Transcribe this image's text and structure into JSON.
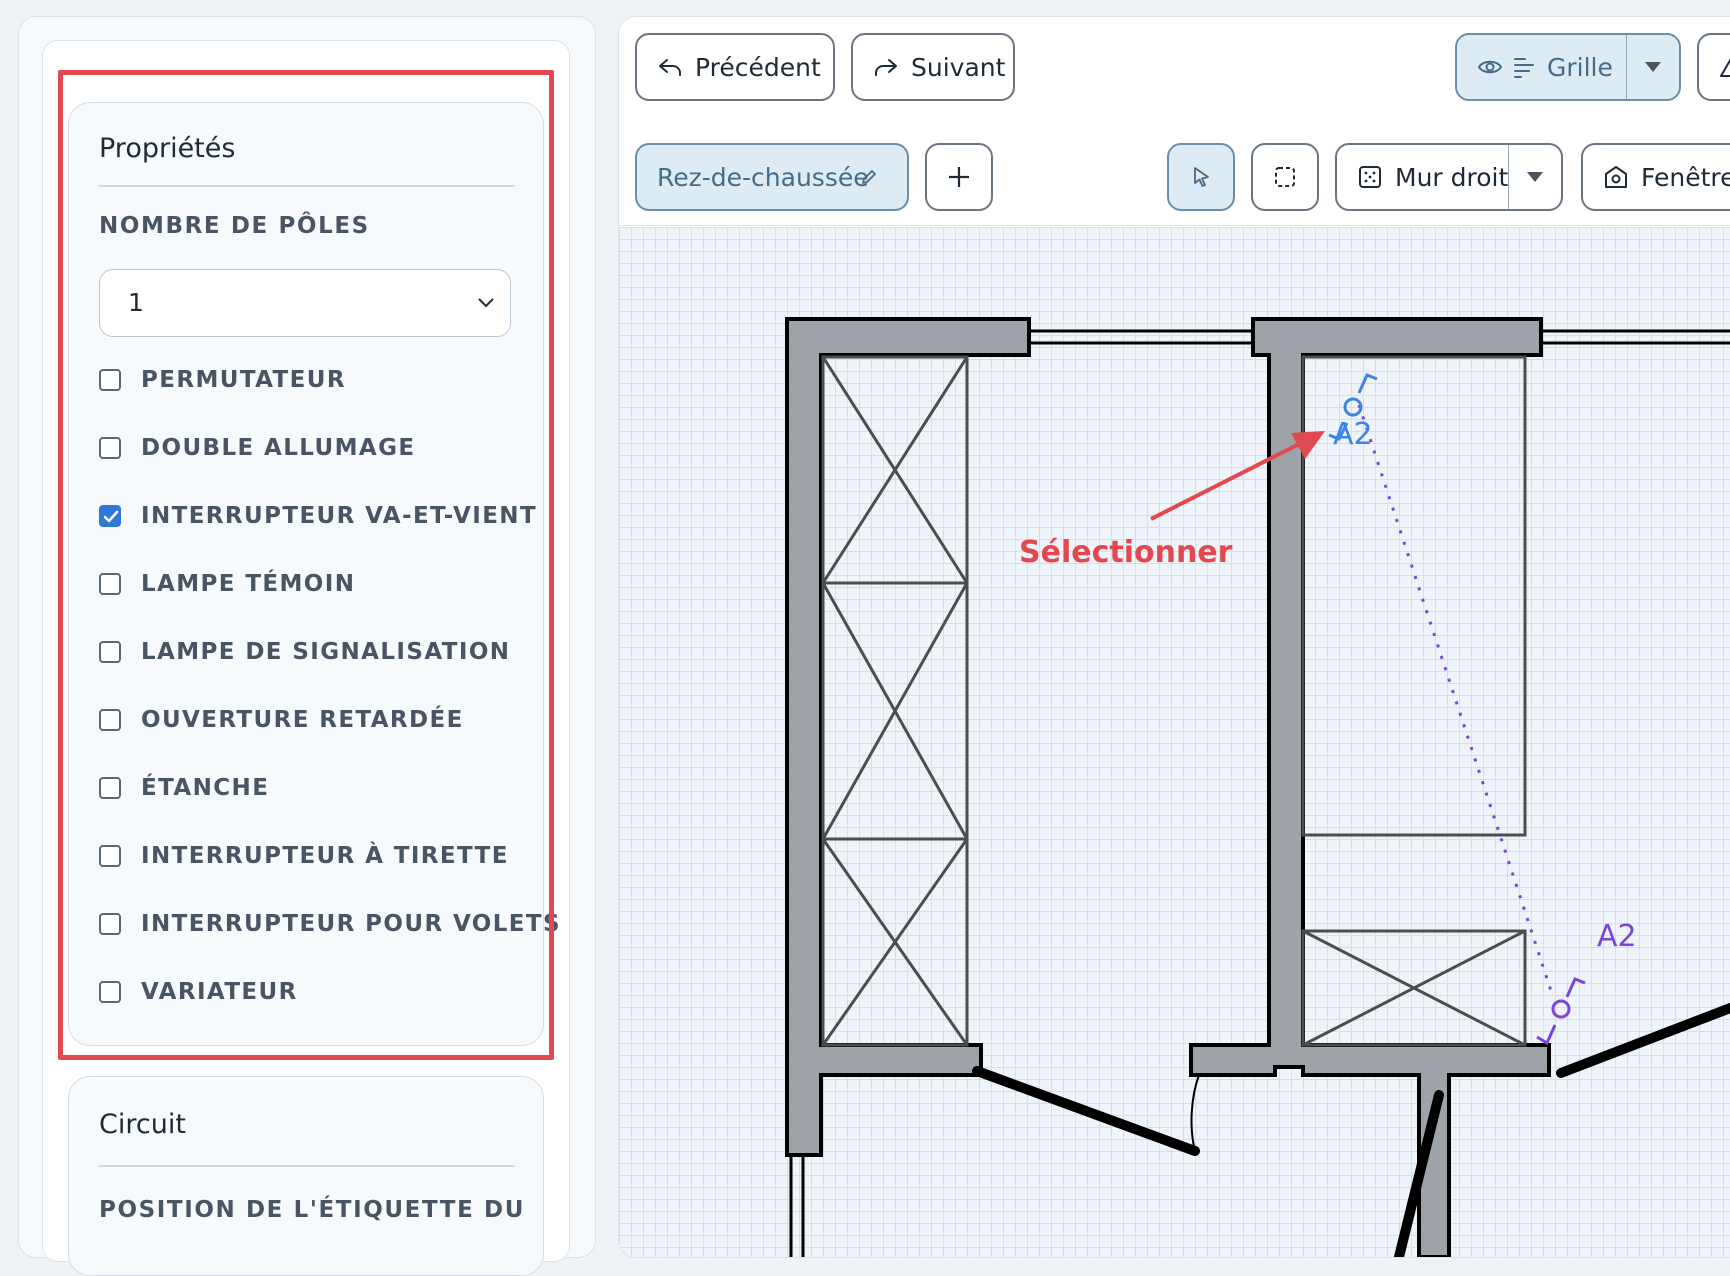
{
  "toolbar": {
    "previous_label": "Précédent",
    "next_label": "Suivant",
    "grid_label": "Grille"
  },
  "floor": {
    "level_label": "Rez-de-chaussée",
    "wall_tool_label": "Mur droit",
    "window_tool_label": "Fenêtre"
  },
  "properties": {
    "title": "Propriétés",
    "poles_label": "NOMBRE DE PÔLES",
    "poles_value": "1",
    "options": [
      {
        "label": "PERMUTATEUR",
        "checked": false
      },
      {
        "label": "DOUBLE ALLUMAGE",
        "checked": false
      },
      {
        "label": "INTERRUPTEUR VA-ET-VIENT",
        "checked": true
      },
      {
        "label": "LAMPE TÉMOIN",
        "checked": false
      },
      {
        "label": "LAMPE DE SIGNALISATION",
        "checked": false
      },
      {
        "label": "OUVERTURE RETARDÉE",
        "checked": false
      },
      {
        "label": "ÉTANCHE",
        "checked": false
      },
      {
        "label": "INTERRUPTEUR À TIRETTE",
        "checked": false
      },
      {
        "label": "INTERRUPTEUR POUR VOLETS",
        "checked": false
      },
      {
        "label": "VARIATEUR",
        "checked": false
      }
    ]
  },
  "circuit": {
    "title": "Circuit",
    "label_position_text": "POSITION DE L'ÉTIQUETTE DU"
  },
  "canvas": {
    "annotation_text": "Sélectionner",
    "switch_a_label": "A2",
    "switch_b_label": "A2"
  },
  "colors": {
    "highlight": "#e2484f",
    "checkbox_checked": "#2f77d8",
    "switch_blue": "#3d84e6",
    "switch_purple": "#7b44db",
    "wall_fill": "#9ea3aa"
  }
}
